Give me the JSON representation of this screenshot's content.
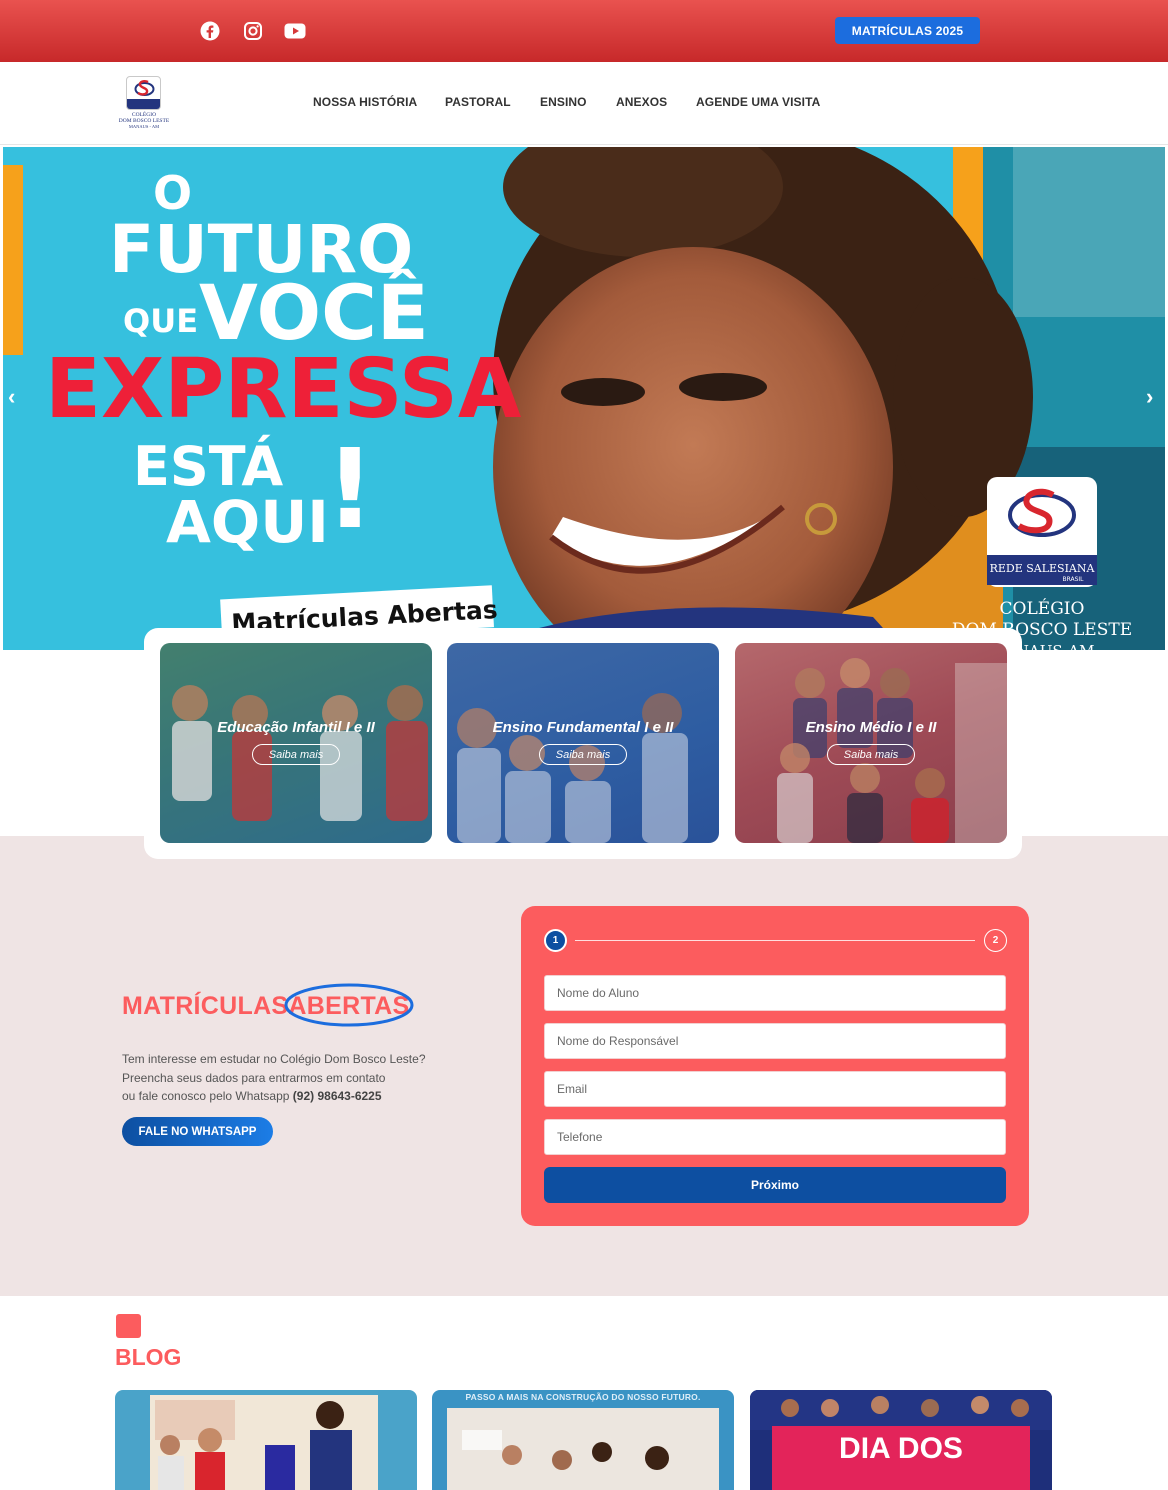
{
  "topbar": {
    "social": [
      "facebook-icon",
      "instagram-icon",
      "youtube-icon"
    ],
    "cta": "MATRÍCULAS 2025"
  },
  "nav": {
    "logo_text": [
      "REDE SALESIANA",
      "COLÉGIO",
      "DOM BOSCO LESTE",
      "MANAUS - AM"
    ],
    "menu": [
      "NOSSA HISTÓRIA",
      "PASTORAL",
      "ENSINO",
      "ANEXOS",
      "AGENDE UMA VISITA"
    ]
  },
  "hero": {
    "line1": "O",
    "line2": "FUTURO",
    "line3a": "QUE",
    "line3b": "VOCÊ",
    "line4": "EXPRESSA",
    "line5": "ESTÁ",
    "line6": "AQUI",
    "excl": "!",
    "tag": "Matrículas Abertas",
    "brand": "REDE SALESIANA",
    "brand_sub": "BRASIL",
    "school1": "COLÉGIO",
    "school2": "DOM BOSCO LESTE",
    "school3": "MANAUS-AM",
    "prev": "‹",
    "next": "›"
  },
  "cards": [
    {
      "title": "Educação Infantil I e II",
      "cta": "Saiba mais"
    },
    {
      "title": "Ensino Fundamental I e II",
      "cta": "Saiba mais"
    },
    {
      "title": "Ensino Médio I e II",
      "cta": "Saiba mais"
    }
  ],
  "enroll": {
    "title_a": "MATRÍCULAS",
    "title_b": "ABERTAS",
    "desc1": "Tem interesse em estudar no Colégio Dom Bosco Leste?",
    "desc2": "Preencha seus dados para entrarmos em contato",
    "desc3": "ou fale conosco pelo Whatsapp",
    "phone": "(92) 98643-6225",
    "whatsapp": "FALE NO WHATSAPP"
  },
  "form": {
    "step1": "1",
    "step2": "2",
    "fields": [
      "Nome do Aluno",
      "Nome do Responsável",
      "Email",
      "Telefone"
    ],
    "submit": "Próximo"
  },
  "blog": {
    "title": "BLOG",
    "card2_caption": "PASSO A MAIS NA CONSTRUÇÃO DO NOSSO FUTURO.",
    "card3_caption": "DIA DOS"
  },
  "colors": {
    "red": "#fc5c5e",
    "blue": "#0d4fa1",
    "accent": "#1c6dde"
  }
}
